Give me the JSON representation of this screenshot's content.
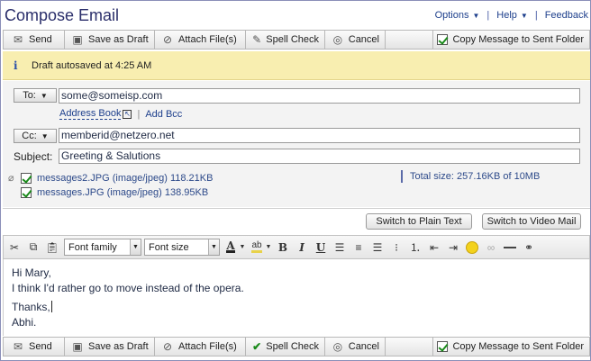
{
  "header": {
    "title": "Compose Email",
    "links": [
      {
        "label": "Options",
        "has_menu": true
      },
      {
        "label": "Help",
        "has_menu": true
      },
      {
        "label": "Feedback",
        "has_menu": false
      }
    ]
  },
  "toolbar": {
    "send": "Send",
    "save_draft": "Save as Draft",
    "attach": "Attach File(s)",
    "spell": "Spell Check",
    "cancel": "Cancel",
    "copy_sent": "Copy Message to Sent Folder",
    "copy_sent_checked": true
  },
  "notice": {
    "text": "Draft autosaved at 4:25 AM"
  },
  "compose": {
    "to_label": "To:",
    "to_value": "some@someisp.com",
    "address_book": "Address Book",
    "add_bcc": "Add Bcc",
    "cc_label": "Cc:",
    "cc_value": "memberid@netzero.net",
    "subject_label": "Subject:",
    "subject_value": "Greeting & Salutions"
  },
  "attachments": {
    "items": [
      {
        "name": "messages2.JPG (image/jpeg) 118.21KB",
        "checked": true
      },
      {
        "name": "messages.JPG (image/jpeg) 138.95KB",
        "checked": true
      }
    ],
    "total": "Total size:  257.16KB  of  10MB"
  },
  "switch": {
    "plain_text": "Switch to Plain Text",
    "video_mail": "Switch to Video Mail"
  },
  "editor": {
    "font_family": "Font family",
    "font_size": "Font size",
    "icons": [
      "cut-icon",
      "copy-icon",
      "paste-icon",
      "font-color-icon",
      "highlight-icon",
      "bold-icon",
      "italic-icon",
      "underline-icon",
      "align-left-icon",
      "align-center-icon",
      "align-right-icon",
      "bullet-list-icon",
      "numbered-list-icon",
      "outdent-icon",
      "indent-icon",
      "emoticon-icon",
      "link-icon",
      "horizontal-rule-icon",
      "find-icon"
    ],
    "body_lines": [
      "Hi Mary,",
      "I think I'd rather go to move instead of the opera.",
      "",
      "Thanks,",
      "Abhi."
    ]
  },
  "colors": {
    "notice_bg": "#f8eeb0",
    "title": "#2b2f6b",
    "link": "#1d3f8c",
    "check": "#1a8a1a"
  }
}
